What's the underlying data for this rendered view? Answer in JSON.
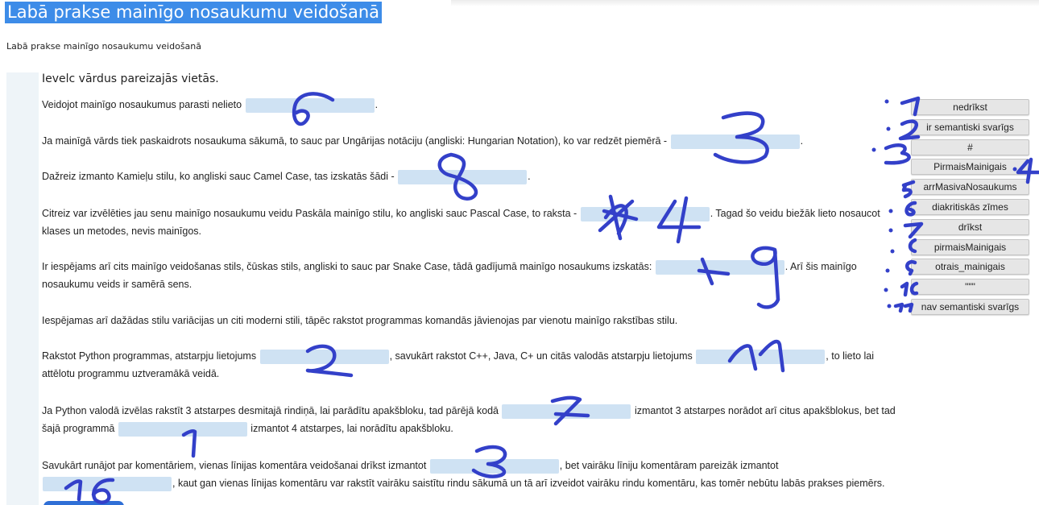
{
  "page": {
    "title": "Labā prakse mainīgo nosaukumu veidošanā",
    "subtitle": "Labā prakse mainīgo nosaukumu veidošanā"
  },
  "task": {
    "instructions": "Ievelc vārdus pareizajās vietās.",
    "paragraphs": [
      {
        "before": "Veidojot mainīgo nosaukumus parasti nelieto",
        "after": "."
      },
      {
        "before": "Ja mainīgā vārds tiek paskaidrots nosaukuma sākumā, to sauc par Ungārijas notāciju (angliski: Hungarian Notation), ko var redzēt piemērā -",
        "after": "."
      },
      {
        "before": "Dažreiz izmanto Kamieļu stilu, ko angliski sauc Camel Case, tas izskatās šādi -",
        "after": "."
      },
      {
        "before": "Citreiz var izvēlēties jau senu mainīgo nosaukumu veidu Paskāla mainīgo stilu, ko angliski sauc Pascal Case, to raksta -",
        "after": ". Tagad šo veidu biežāk lieto nosaucot klases un metodes, nevis mainīgos."
      },
      {
        "before": "Ir iespējams arī cits mainīgo veidošanas stils, čūskas stils, angliski to sauc par Snake Case, tādā gadījumā mainīgo nosaukums izskatās:",
        "after": ". Arī šis mainīgo nosaukumu veids ir samērā sens."
      },
      {
        "text": "Iespējamas arī dažādas stilu variācijas un citi moderni stili, tāpēc rakstot programmas komandās jāvienojas par vienotu mainīgo rakstības stilu."
      },
      {
        "before": "Rakstot Python programmas, atstarpju lietojums",
        "middle": ", savukārt rakstot C++, Java, C+ un citās valodās atstarpju lietojums",
        "after": ", to lieto lai attēlotu programmu uztveramākā veidā."
      },
      {
        "before": "Ja Python valodā izvēlas rakstīt 3 atstarpes desmitajā rindiņā, lai parādītu apakšbloku, tad pārējā kodā",
        "middle": "izmantot 3 atstarpes norādot arī citus apakšblokus, bet tad šajā programmā",
        "after": "izmantot 4 atstarpes, lai norādītu apakšbloku."
      },
      {
        "before": "Savukārt runājot par komentāriem, vienas līnijas komentāra veidošanai drīkst izmantot",
        "middle": ", bet vairāku līniju komentāram pareizāk izmantot",
        "after": ", kaut gan vienas līnijas komentāru var rakstīt vairāku saistītu rindu sākumā un tā arī izveidot vairāku rindu komentāru, kas tomēr nebūtu labās prakses piemērs."
      }
    ]
  },
  "word_bank": [
    "nedrīkst",
    "ir semantiski svarīgs",
    "#",
    "PirmaisMainigais",
    "arrMasivaNosaukums",
    "diakritiskās zīmes",
    "drīkst",
    "pirmaisMainigais",
    "otrais_mainigais",
    "\"\"\"",
    "nav semantiski svarīgs"
  ],
  "annotations": {
    "color": "#3340c9",
    "note": "handwritten numbers drawn over the screenshot",
    "blank_numbers": [
      "6",
      "3",
      "8",
      "4",
      "9",
      "2",
      "11",
      "7",
      "1",
      "3",
      "16"
    ],
    "bank_numbers": [
      "1",
      "2",
      "3",
      "4",
      "5",
      "6",
      "7",
      "8",
      "9",
      "10",
      "11"
    ]
  },
  "colors": {
    "title_bg": "#3d8ce8",
    "blank_fill": "#cfe2f3",
    "chip_bg": "#e6e6e6"
  }
}
